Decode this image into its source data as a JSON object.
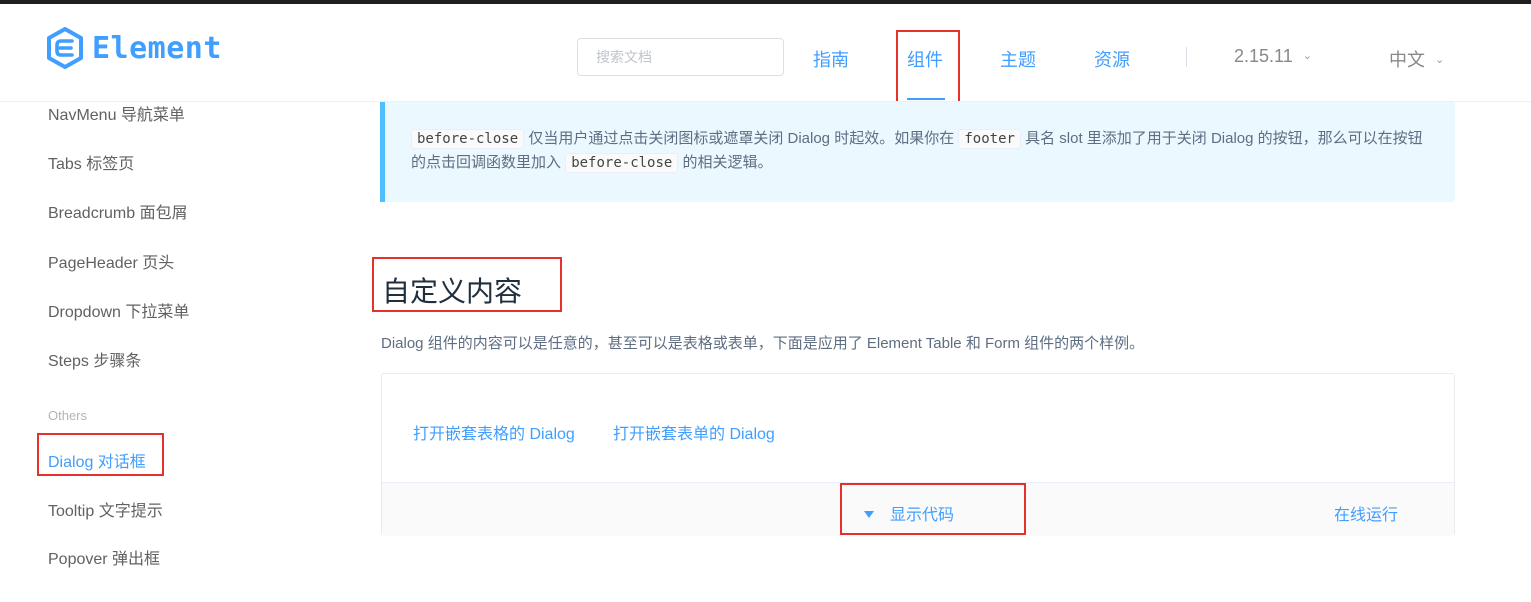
{
  "header": {
    "logo_text": "Element",
    "search": {
      "placeholder": "搜索文档",
      "value": ""
    },
    "nav": [
      {
        "label": "指南"
      },
      {
        "label": "组件"
      },
      {
        "label": "主题"
      },
      {
        "label": "资源"
      }
    ],
    "version": "2.15.11",
    "language": "中文",
    "chevron": "⌄"
  },
  "sidebar": {
    "items_top": [
      {
        "label": "NavMenu 导航菜单"
      },
      {
        "label": "Tabs 标签页"
      },
      {
        "label": "Breadcrumb 面包屑"
      },
      {
        "label": "PageHeader 页头"
      },
      {
        "label": "Dropdown 下拉菜单"
      },
      {
        "label": "Steps 步骤条"
      }
    ],
    "group_label": "Others",
    "items_others": [
      {
        "label": "Dialog 对话框"
      },
      {
        "label": "Tooltip 文字提示"
      },
      {
        "label": "Popover 弹出框"
      }
    ]
  },
  "main": {
    "tip": {
      "code_before_close": "before-close",
      "text1": "仅当用户通过点击关闭图标或遮罩关闭 Dialog 时起效。如果你在",
      "code_footer": "footer",
      "text2": "具名 slot 里添加了用于关闭 Dialog 的按钮，那么可以在按钮的点击回调函数里加入",
      "text3": "的相关逻辑。"
    },
    "section_title": "自定义内容",
    "description": "Dialog 组件的内容可以是任意的，甚至可以是表格或表单，下面是应用了 Element Table 和 Form 组件的两个样例。",
    "demo": {
      "buttons": [
        {
          "label": "打开嵌套表格的 Dialog"
        },
        {
          "label": "打开嵌套表单的 Dialog"
        }
      ],
      "show_code": "显示代码",
      "run_online": "在线运行"
    }
  },
  "colors": {
    "brand": "#409eff",
    "highlight_box": "#e6302c",
    "tip_bg": "#ecf8ff",
    "tip_border": "#50bfff"
  }
}
